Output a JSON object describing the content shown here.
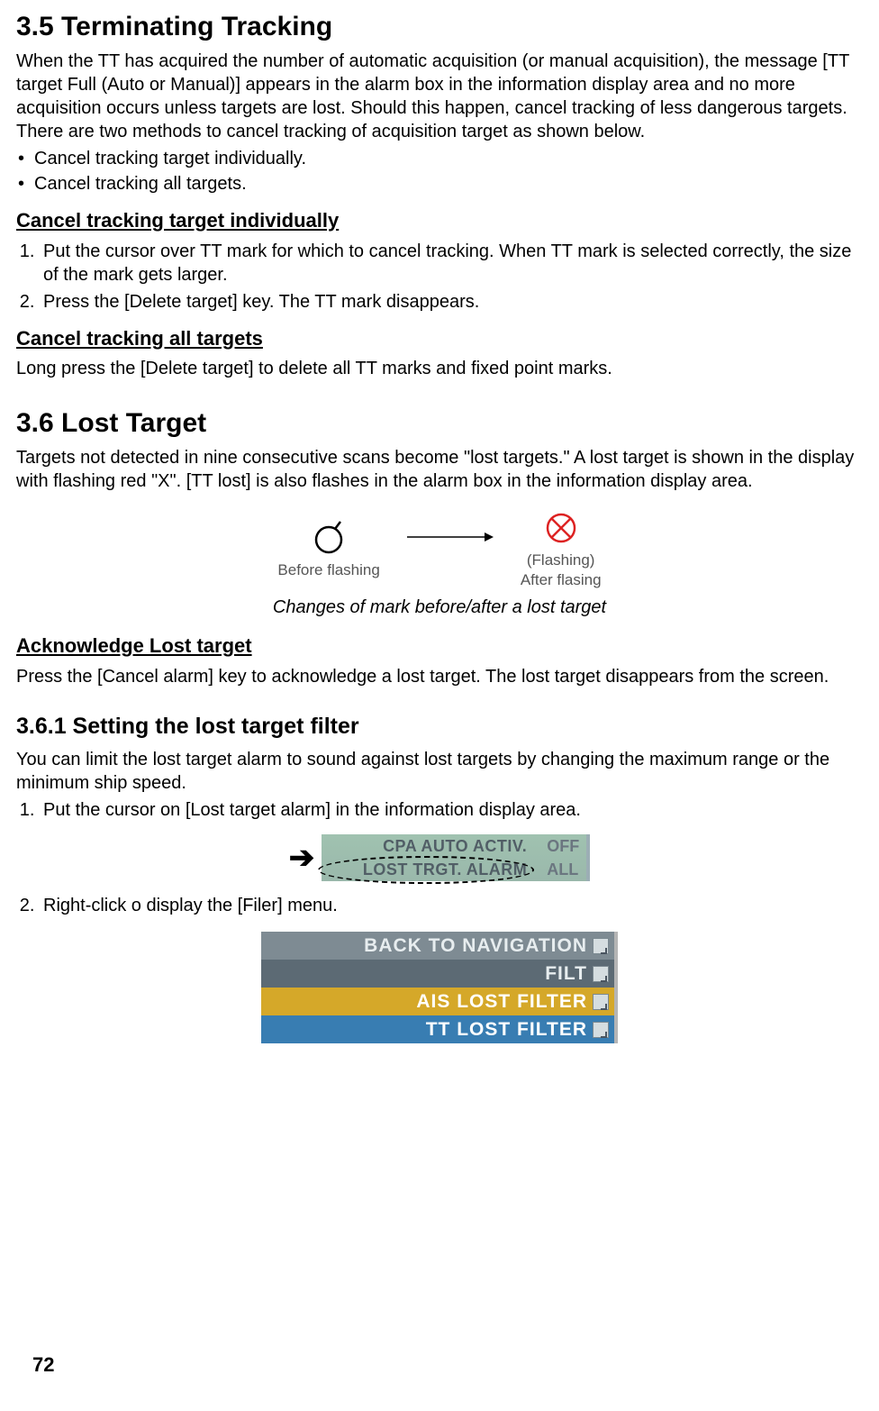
{
  "section35": {
    "heading": "3.5  Terminating Tracking",
    "intro": "When the TT has acquired the number of automatic acquisition (or manual acquisition), the message [TT target Full (Auto or Manual)] appears in the alarm box in the information display area and no more acquisition occurs unless targets are lost. Should this happen, cancel tracking of less dangerous targets. There are two methods to cancel tracking of acquisition target as shown below.",
    "bullets": [
      "Cancel tracking target individually.",
      "Cancel tracking all targets."
    ],
    "sub1_heading": "Cancel tracking target individually",
    "sub1_steps": [
      "Put the cursor over TT mark for which to cancel tracking. When TT mark is selected correctly, the size of the mark gets larger.",
      "Press the [Delete target] key. The TT mark disappears."
    ],
    "sub2_heading": "Cancel tracking all targets",
    "sub2_text": "Long press the [Delete target] to delete all TT marks and fixed point marks."
  },
  "section36": {
    "heading": "3.6  Lost Target",
    "intro": "Targets not detected in nine consecutive scans become \"lost targets.\" A lost target is shown in the display with flashing red \"X\".  [TT lost] is also flashes in the alarm box in the information display area.",
    "figure": {
      "before_label": "Before flashing",
      "after_label_line1": "(Flashing)",
      "after_label_line2": "After flasing",
      "caption": "Changes of mark before/after a lost target"
    },
    "ack_heading": "Acknowledge Lost target",
    "ack_text": "Press the [Cancel alarm] key to acknowledge a lost target. The lost target disappears from the screen.",
    "sub361": {
      "heading": "3.6.1 Setting the lost target filter",
      "intro": "You can limit the lost target alarm to sound against lost targets by changing the maximum range or the minimum ship speed.",
      "steps": [
        "Put the cursor on [Lost target alarm] in the information display area.",
        "Right-click o display the [Filer] menu."
      ],
      "radar_panel": {
        "row1_label": "CPA AUTO ACTIV.",
        "row1_value": "OFF",
        "row2_label": "LOST TRGT. ALARM",
        "row2_value": "ALL"
      },
      "menu": {
        "item1": "BACK TO NAVIGATION",
        "item2": "FILT",
        "item3": "AIS LOST FILTER",
        "item4": "TT LOST FILTER"
      }
    }
  },
  "page_number": "72"
}
